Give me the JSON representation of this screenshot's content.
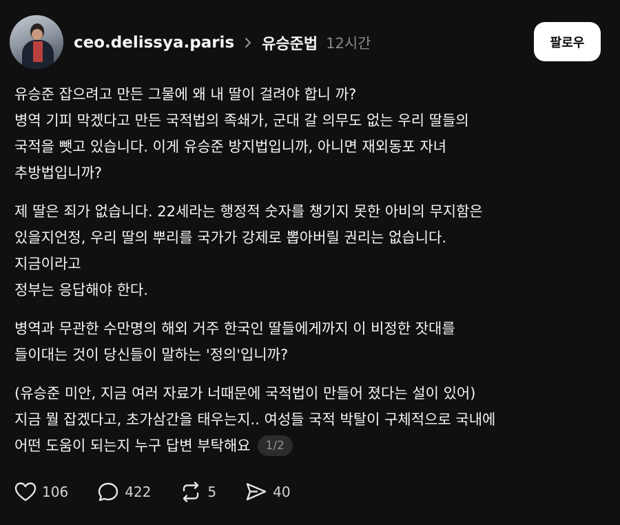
{
  "post": {
    "username": "ceo.delissya.paris",
    "topic": "유승준법",
    "time": "12시간",
    "follow_label": "팔로우",
    "paragraphs": [
      [
        "유승준 잡으려고 만든 그물에 왜 내 딸이 걸려야 합니 까?",
        "병역 기피 막겠다고 만든 국적법의 족쇄가, 군대 갈 의무도 없는 우리 딸들의",
        "국적을 뺏고 있습니다. 이게 유승준 방지법입니까, 아니면 재외동포 자녀",
        "추방법입니까?"
      ],
      [
        "제 딸은 죄가 없습니다. 22세라는 행정적 숫자를 챙기지 못한 아비의 무지함은",
        "있을지언정, 우리 딸의 뿌리를 국가가 강제로 뽑아버릴 권리는 없습니다.",
        "지금이라고",
        "정부는 응답해야 한다."
      ],
      [
        "병역과 무관한 수만명의 해외 거주 한국인 딸들에게까지 이 비정한 잣대를",
        "들이대는 것이 당신들이 말하는 '정의'입니까?"
      ],
      [
        "(유승준 미안, 지금 여러 자료가 너때문에 국적법이 만들어 졌다는 설이 있어)",
        "지금 뭘 잡겠다고, 초가삼간을 태우는지.. 여성들 국적 박탈이 구체적으로 국내에",
        "어떤 도움이  되는지 누구 답변 부탁해요"
      ]
    ],
    "page_indicator": "1/2"
  },
  "actions": {
    "likes": "106",
    "comments": "422",
    "reposts": "5",
    "shares": "40"
  },
  "icons": {
    "like": "heart-icon",
    "comment": "comment-bubble-icon",
    "repost": "repost-icon",
    "share": "send-icon",
    "separator": "chevron-right-icon"
  },
  "colors": {
    "background": "#101010",
    "text": "#f3f5f7",
    "muted": "#8a8a8a",
    "button_bg": "#ffffff"
  }
}
